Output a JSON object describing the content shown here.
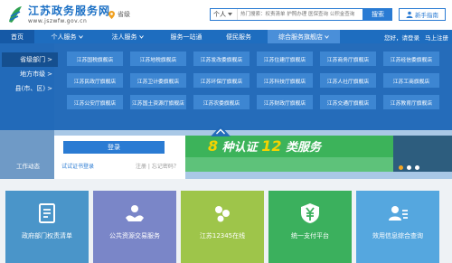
{
  "header": {
    "site_name": "江苏政务服务网",
    "site_url": "www.jszwfw.gov.cn",
    "location": "省级",
    "search_scope": "个人",
    "search_placeholder": "热门搜索：权责清单 护照办理 医保查询 公积金查询",
    "search_button": "搜索",
    "guide_button": "新手指南"
  },
  "nav": {
    "items": [
      {
        "label": "首页"
      },
      {
        "label": "个人服务"
      },
      {
        "label": "法人服务"
      },
      {
        "label": "服务一站通"
      },
      {
        "label": "便民服务"
      },
      {
        "label": "综合服务旗舰店"
      }
    ],
    "greeting": "您好，请登录",
    "register": "马上注册"
  },
  "mega_menu": {
    "side": [
      {
        "label": "省级部门"
      },
      {
        "label": "地方市级"
      },
      {
        "label": "县(市、区)"
      }
    ],
    "cells": [
      "江苏国税旗舰店",
      "江苏地税旗舰店",
      "江苏发改委旗舰店",
      "江苏住建厅旗舰店",
      "江苏商务厅旗舰店",
      "江苏经信委旗舰店",
      "江苏民政厅旗舰店",
      "江苏卫计委旗舰店",
      "江苏环保厅旗舰店",
      "江苏科技厅旗舰店",
      "江苏人社厅旗舰店",
      "江苏工商旗舰店",
      "江苏公安厅旗舰店",
      "江苏国土资源厅旗舰店",
      "江苏农委旗舰店",
      "江苏财政厅旗舰店",
      "江苏交通厅旗舰店",
      "江苏教育厅旗舰店"
    ]
  },
  "banner": {
    "work_label": "工作动态",
    "login_button": "登录",
    "link_cert": "试试证书登录",
    "link_forgot": "注册 | 忘记密码？",
    "slogan_num1": "8",
    "slogan_mid": "种认证",
    "slogan_num2": "12",
    "slogan_end": "类服务"
  },
  "tiles": [
    {
      "label": "政府部门权责清单",
      "color": "#4a95c9"
    },
    {
      "label": "公共资源交易服务",
      "color": "#7a86c8"
    },
    {
      "label": "江苏12345在线",
      "color": "#9ec54a"
    },
    {
      "label": "统一支付平台",
      "color": "#3bb05d"
    },
    {
      "label": "效用信息综合查询",
      "color": "#55a7df"
    }
  ],
  "colors": {
    "brand": "#1e6dbf",
    "accent": "#2a7bd3",
    "menu_bg": "#1f68b8",
    "menu_cell": "#3d86d2"
  }
}
